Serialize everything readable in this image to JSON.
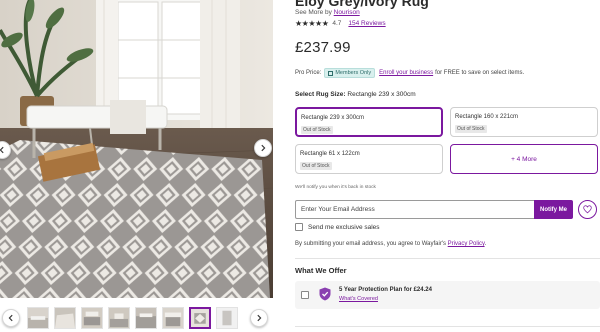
{
  "product": {
    "title": "Eloy Grey/Ivory Rug",
    "see_more_prefix": "See More by",
    "brand": "Nourison",
    "stars": "★★★★★",
    "rating": "4.7",
    "reviews": "154 Reviews",
    "price": "£237.99"
  },
  "pro_price": {
    "label": "Pro Price:",
    "badge": "Members Only",
    "enroll_link": "Enroll your business",
    "rest": "for FREE to save on select items."
  },
  "size": {
    "label": "Select Rug Size:",
    "selected": "Rectangle 239 x 300cm",
    "options": [
      {
        "name": "Rectangle 239 x 300cm",
        "status": "Out of Stock"
      },
      {
        "name": "Rectangle 160 x 221cm",
        "status": "Out of Stock"
      },
      {
        "name": "Rectangle 61 x 122cm",
        "status": "Out of Stock"
      }
    ],
    "more_label": "+ 4 More"
  },
  "notify": {
    "note": "We'll notify you when it's back in stock",
    "placeholder": "Enter Your Email Address",
    "button": "Notify Me",
    "exclusive": "Send me exclusive sales",
    "agree_prefix": "By submitting your email address, you agree to Wayfair's",
    "privacy_link": "Privacy Policy",
    "agree_suffix": "."
  },
  "offer": {
    "title": "What We Offer",
    "plan": "5 Year Protection Plan for £24.24",
    "covered": "What's Covered"
  },
  "colors": {
    "accent": "#7b189f",
    "members_bg": "#d9f0ee"
  },
  "gallery": {
    "thumbnail_count": 8,
    "active_thumbnail": 7
  }
}
